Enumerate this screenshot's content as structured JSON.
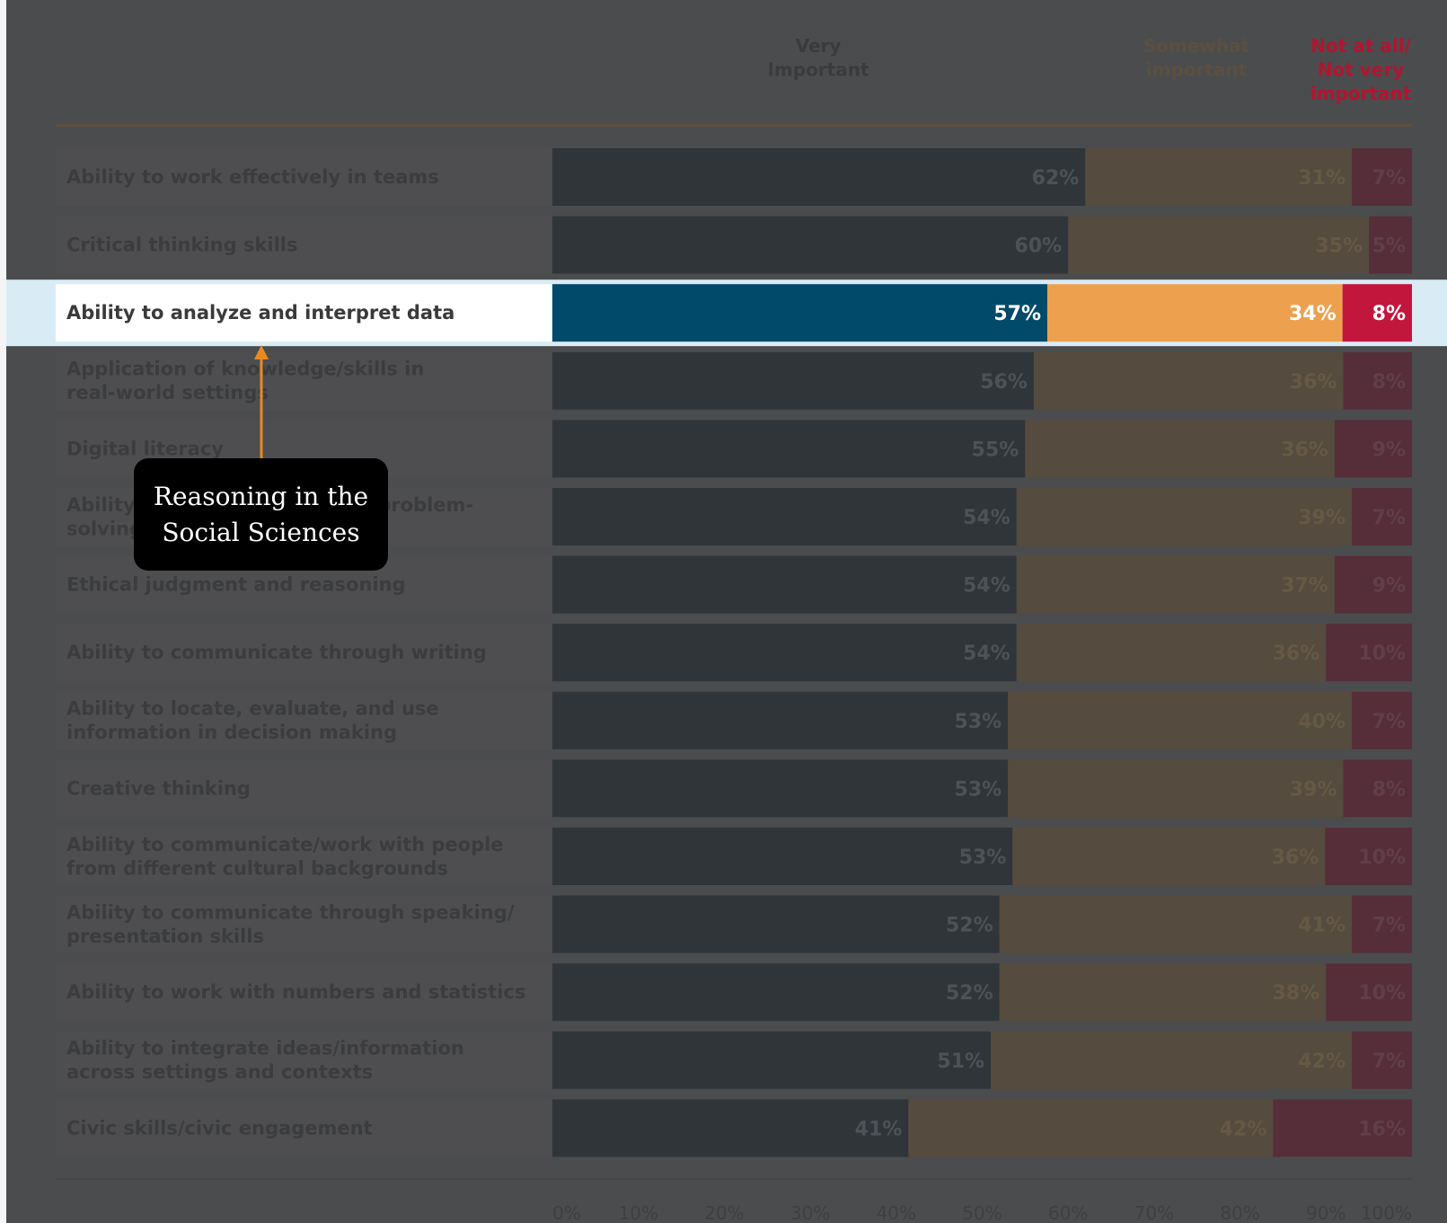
{
  "chart_data": {
    "type": "bar",
    "orientation": "horizontal",
    "stacked": true,
    "headers": [
      "Very\nImportant",
      "Somewhat\nimportant",
      "Not at all/\nNot very\nimportant"
    ],
    "categories": [
      "Ability to work effectively in teams",
      "Critical thinking skills",
      "Ability to analyze and interpret data",
      "Application of knowledge/skills in\nreal-world settings",
      "Digital literacy",
      "Ability to engage in complex problem-\nsolving",
      "Ethical judgment and reasoning",
      "Ability to communicate through writing",
      "Ability to locate, evaluate, and use\ninformation in decision making",
      "Creative thinking",
      "Ability to communicate/work with people\nfrom different cultural backgrounds",
      "Ability to communicate through speaking/\npresentation skills",
      "Ability to work with numbers and statistics",
      "Ability to integrate ideas/information\nacross settings and contexts",
      "Civic skills/civic engagement"
    ],
    "series": [
      {
        "name": "Very Important",
        "values": [
          62,
          60,
          57,
          56,
          55,
          54,
          54,
          54,
          53,
          53,
          53,
          52,
          52,
          51,
          41
        ]
      },
      {
        "name": "Somewhat important",
        "values": [
          31,
          35,
          34,
          36,
          36,
          39,
          37,
          36,
          40,
          39,
          36,
          41,
          38,
          42,
          42
        ]
      },
      {
        "name": "Not at all/Not very important",
        "values": [
          7,
          5,
          8,
          8,
          9,
          7,
          9,
          10,
          7,
          8,
          10,
          7,
          10,
          7,
          16
        ]
      }
    ],
    "xticks": [
      "0%",
      "10%",
      "20%",
      "30%",
      "40%",
      "50%",
      "60%",
      "70%",
      "80%",
      "90%",
      "100%"
    ],
    "xlim": [
      0,
      100
    ],
    "highlighted_category_index": 2,
    "colors": {
      "very": "#024a6a",
      "somewhat": "#eda14f",
      "not": "#c2163d",
      "dim_very": "#2f3539",
      "dim_somewhat": "#554b3e",
      "dim_not": "#552e39",
      "dim_bg": "#4b4c4e",
      "label_bg": "#4e4e50",
      "accent_line": "#ea8a1e"
    }
  },
  "callout": {
    "text": "Reasoning in the\nSocial Sciences"
  }
}
